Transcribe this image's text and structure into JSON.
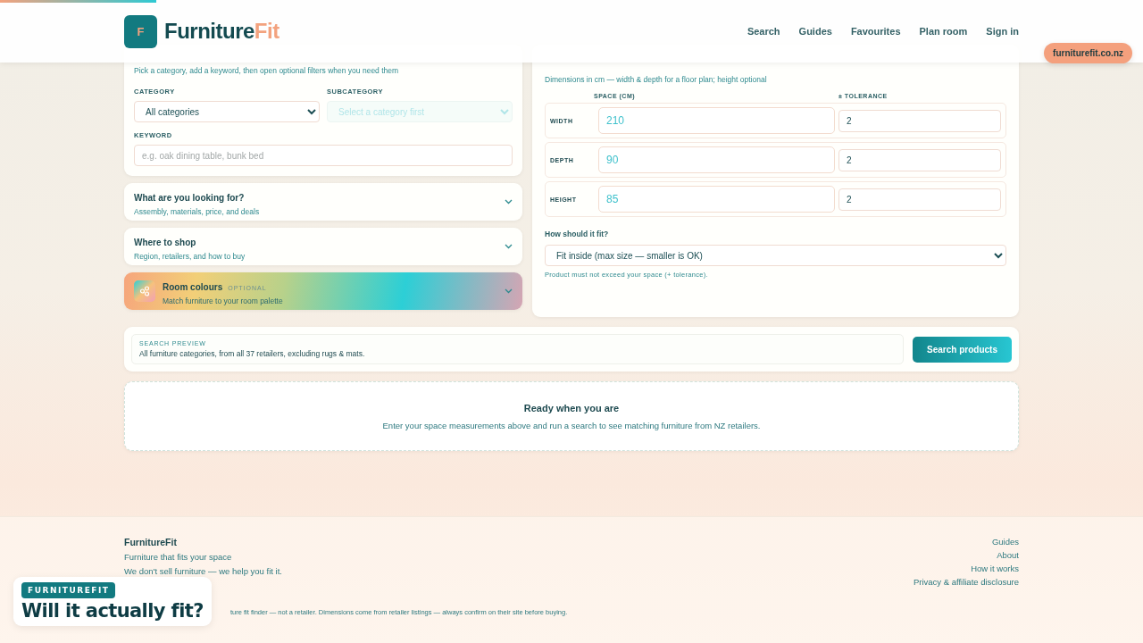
{
  "header": {
    "logo_letter": "F",
    "brand": "Furniture",
    "brand_accent": "Fit",
    "nav": [
      "Search",
      "Guides",
      "Favourites",
      "Plan room",
      "Sign in"
    ]
  },
  "domain_badge": "furniturefit.co.nz",
  "filters": {
    "subtitle": "Pick a category, add a keyword, then open optional filters when you need them",
    "category": {
      "label": "CATEGORY",
      "value": "All categories"
    },
    "subcategory": {
      "label": "SUBCATEGORY",
      "value": "Select a category first",
      "disabled": true
    },
    "keyword": {
      "label": "KEYWORD",
      "placeholder": "e.g. oak dining table, bunk bed"
    }
  },
  "sections": [
    {
      "kind": "plain",
      "title": "What are you looking for?",
      "subtitle": "Assembly, materials, price, and deals",
      "expanded": false
    },
    {
      "kind": "plain",
      "title": "Where to shop",
      "subtitle": "Region, retailers, and how to buy",
      "expanded": false
    },
    {
      "kind": "colour",
      "title": "Room colours",
      "badge": "OPTIONAL",
      "subtitle": "Match furniture to your room palette",
      "expanded": false
    }
  ],
  "space": {
    "subtitle": "Dimensions in cm — width & depth for a floor plan; height optional",
    "columns": [
      "SPACE (CM)",
      "± TOLERANCE"
    ],
    "rows": [
      {
        "label": "WIDTH",
        "value": "210",
        "tolerance": "2"
      },
      {
        "label": "DEPTH",
        "value": "90",
        "tolerance": "2"
      },
      {
        "label": "HEIGHT",
        "value": "85",
        "tolerance": "2"
      }
    ],
    "fit_label": "How should it fit?",
    "fit_value": "Fit inside (max size — smaller is OK)",
    "fit_hint": "Product must not exceed your space (+ tolerance)."
  },
  "preview": {
    "label": "SEARCH PREVIEW",
    "text": "All furniture categories, from all 37 retailers, excluding rugs & mats.",
    "button": "Search products"
  },
  "empty_state": {
    "title": "Ready when you are",
    "text": "Enter your space measurements above and run a search to see matching furniture from NZ retailers."
  },
  "footer": {
    "brand": "FurnitureFit",
    "tagline": "Furniture that fits your space",
    "note": "We don't sell furniture — we help you fit it.",
    "links": [
      "Guides",
      "About",
      "How it works",
      "Privacy & affiliate disclosure"
    ],
    "disclaimer": "ture fit finder — not a retailer. Dimensions come from retailer listings — always confirm on their site before buying."
  },
  "overlay_card": {
    "badge": "FURNITUREFIT",
    "title": "Will it actually fit?"
  }
}
